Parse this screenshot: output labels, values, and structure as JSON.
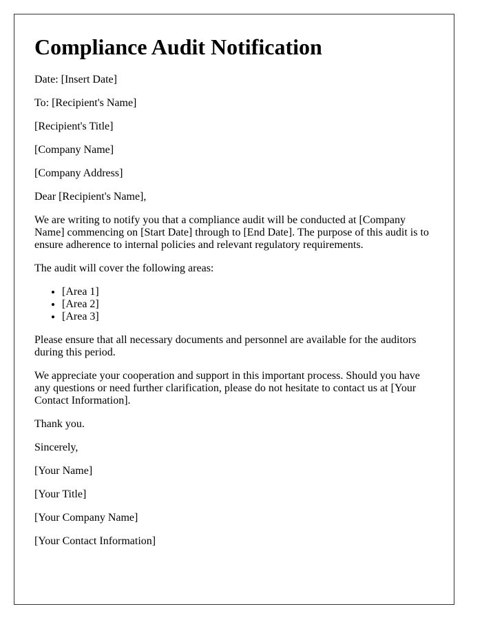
{
  "letter": {
    "title": "Compliance Audit Notification",
    "date_line": "Date: [Insert Date]",
    "recipient": {
      "to_line": "To: [Recipient's Name]",
      "title": "[Recipient's Title]",
      "company_name": "[Company Name]",
      "company_address": "[Company Address]"
    },
    "salutation": "Dear [Recipient's Name],",
    "body": {
      "intro": "We are writing to notify you that a compliance audit will be conducted at [Company Name] commencing on [Start Date] through to [End Date]. The purpose of this audit is to ensure adherence to internal policies and relevant regulatory requirements.",
      "areas_intro": "The audit will cover the following areas:",
      "areas": [
        "[Area 1]",
        "[Area 2]",
        "[Area 3]"
      ],
      "request": "Please ensure that all necessary documents and personnel are available for the auditors during this period.",
      "appreciation": "We appreciate your cooperation and support in this important process. Should you have any questions or need further clarification, please do not hesitate to contact us at [Your Contact Information].",
      "thanks": "Thank you."
    },
    "closing": "Sincerely,",
    "signature": {
      "name": "[Your Name]",
      "title": "[Your Title]",
      "company_name": "[Your Company Name]",
      "contact_info": "[Your Contact Information]"
    }
  }
}
